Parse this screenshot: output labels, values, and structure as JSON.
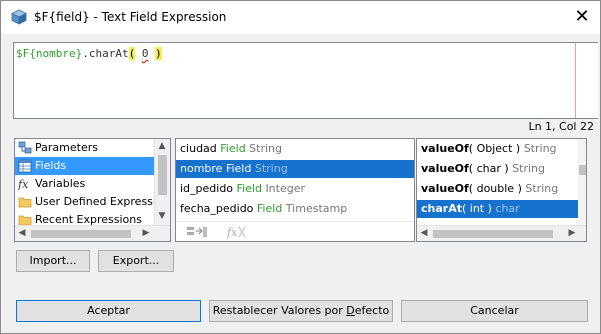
{
  "window": {
    "title": "$F{field} - Text Field Expression",
    "close_glyph": "✕"
  },
  "editor": {
    "expression": {
      "field": "$F{nombre}",
      "method": ".charAt",
      "open_paren": "(",
      "space1": " ",
      "arg": "0",
      "space2": " ",
      "close_paren": ")"
    },
    "caret_position": "Ln 1, Col 22"
  },
  "categories": [
    {
      "label": "Parameters",
      "icon": "parameters-icon",
      "selected": false
    },
    {
      "label": "Fields",
      "icon": "fields-icon",
      "selected": true
    },
    {
      "label": "Variables",
      "icon": "fx-variables-icon",
      "selected": false
    },
    {
      "label": "User Defined Expression",
      "icon": "folder-icon",
      "selected": false
    },
    {
      "label": "Recent Expressions",
      "icon": "folder-icon",
      "selected": false
    }
  ],
  "fields": [
    {
      "name": "ciudad",
      "kind": "Field",
      "type": "String",
      "selected": false
    },
    {
      "name": "nombre",
      "kind": "Field",
      "type": "String",
      "selected": true
    },
    {
      "name": "id_pedido",
      "kind": "Field",
      "type": "Integer",
      "selected": false
    },
    {
      "name": "fecha_pedido",
      "kind": "Field",
      "type": "Timestamp",
      "selected": false
    }
  ],
  "methods": [
    {
      "name": "valueOf",
      "params": "( Object )",
      "returns": "String",
      "selected": false
    },
    {
      "name": "valueOf",
      "params": "( char )",
      "returns": "String",
      "selected": false
    },
    {
      "name": "valueOf",
      "params": "( double )",
      "returns": "String",
      "selected": false
    },
    {
      "name": "charAt",
      "params": "( int )",
      "returns": "char",
      "selected": true
    }
  ],
  "buttons": {
    "import_label": "Import...",
    "export_label": "Export...",
    "accept_label": "Aceptar",
    "reset_label_pre": "Restablecer Valores por ",
    "reset_label_u": "D",
    "reset_label_post": "efecto",
    "cancel_label": "Cancelar"
  },
  "colors": {
    "selection": "#1672cc",
    "category_selection": "#3399ff",
    "field_kind": "#2e9e2e",
    "paren_highlight": "#f5ee55"
  }
}
